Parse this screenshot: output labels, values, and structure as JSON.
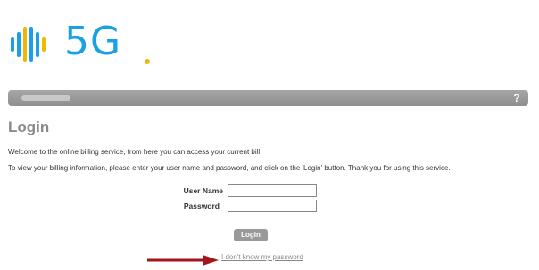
{
  "brand": {
    "logo_text": "5G",
    "colors": {
      "blue": "#1aa0e6",
      "yellow": "#f2b705"
    }
  },
  "nav": {
    "help_label": "?"
  },
  "page": {
    "title": "Login",
    "intro": "Welcome to the online billing service, from here you can access your current bill.",
    "instructions": "To view your billing information, please enter your user name and password, and click on the 'Login' button. Thank you for using this service."
  },
  "form": {
    "username_label": "User Name",
    "username_value": "",
    "password_label": "Password",
    "password_value": "",
    "login_label": "Login"
  },
  "forgot_link": "I don't know my password",
  "annotation": {
    "arrow_color": "#a3161b"
  }
}
